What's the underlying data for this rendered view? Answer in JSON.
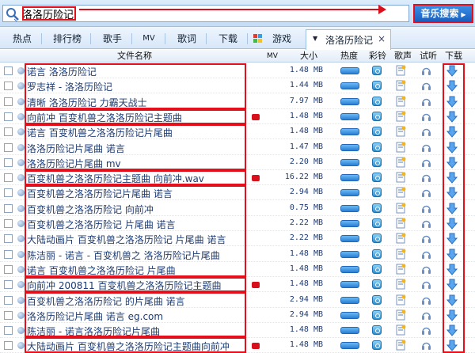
{
  "search": {
    "query": "洛洛历险记",
    "button_label": "音乐搜索"
  },
  "tabs": [
    {
      "label": "热点"
    },
    {
      "label": "排行榜"
    },
    {
      "label": "歌手"
    },
    {
      "label": "MV"
    },
    {
      "label": "歌词"
    },
    {
      "label": "下载"
    },
    {
      "label": "游戏"
    }
  ],
  "active_tab": {
    "label": "洛洛历险记",
    "close": "×"
  },
  "columns": {
    "name": "文件名称",
    "mv": "MV",
    "size": "大小",
    "quality": "热度",
    "ringtone": "彩铃",
    "lyric": "歌声",
    "listen": "试听",
    "download": "下载"
  },
  "colors": {
    "annotation": "#e3101c",
    "link": "#1d3b74",
    "header_bg": "#dcecfb"
  },
  "rows": [
    {
      "name": "诺言 洛洛历险记",
      "mv": false,
      "size": "1.48 MB"
    },
    {
      "name": "罗志祥 - 洛洛历险记",
      "mv": false,
      "size": "1.44 MB"
    },
    {
      "name": "清晰 洛洛历险记 力霸天战士",
      "mv": false,
      "size": "7.97 MB"
    },
    {
      "name": "向前冲 百变机兽之洛洛历险记主题曲",
      "mv": true,
      "size": "1.48 MB"
    },
    {
      "name": "诺言 百变机兽之洛洛历险记片尾曲",
      "mv": false,
      "size": "1.48 MB"
    },
    {
      "name": "洛洛历险记片尾曲 诺言",
      "mv": false,
      "size": "1.47 MB"
    },
    {
      "name": "洛洛历险记片尾曲 mv",
      "mv": false,
      "size": "2.20 MB"
    },
    {
      "name": "百变机兽之洛洛历险记主题曲 向前冲.wav",
      "mv": true,
      "size": "16.22 MB"
    },
    {
      "name": "百变机兽之洛洛历险记片尾曲 诺言",
      "mv": false,
      "size": "2.94 MB"
    },
    {
      "name": "百变机兽之洛洛历险记 向前冲",
      "mv": false,
      "size": "0.75 MB"
    },
    {
      "name": "百变机兽之洛洛历险记 片尾曲 诺言",
      "mv": false,
      "size": "2.22 MB"
    },
    {
      "name": "大陆动画片 百变机兽之洛洛历险记 片尾曲 诺言",
      "mv": false,
      "size": "2.22 MB"
    },
    {
      "name": "陈洁丽 - 诺言 - 百变机兽之 洛洛历险记片尾曲",
      "mv": false,
      "size": "1.48 MB"
    },
    {
      "name": "诺言 百变机兽之洛洛历险记 片尾曲",
      "mv": false,
      "size": "1.48 MB"
    },
    {
      "name": "向前冲 200811 百变机兽之洛洛历险记主题曲",
      "mv": true,
      "size": "1.48 MB"
    },
    {
      "name": "百变机兽之洛洛历险记 的片尾曲 诺言",
      "mv": false,
      "size": "2.94 MB"
    },
    {
      "name": "洛洛历险记片尾曲 诺言 eg.com",
      "mv": false,
      "size": "2.94 MB"
    },
    {
      "name": "陈洁丽 - 诺言洛洛历险记片尾曲",
      "mv": false,
      "size": "1.48 MB"
    },
    {
      "name": "大陆动画片 百变机兽之洛洛历险记主题曲向前冲",
      "mv": true,
      "size": "1.48 MB"
    }
  ]
}
